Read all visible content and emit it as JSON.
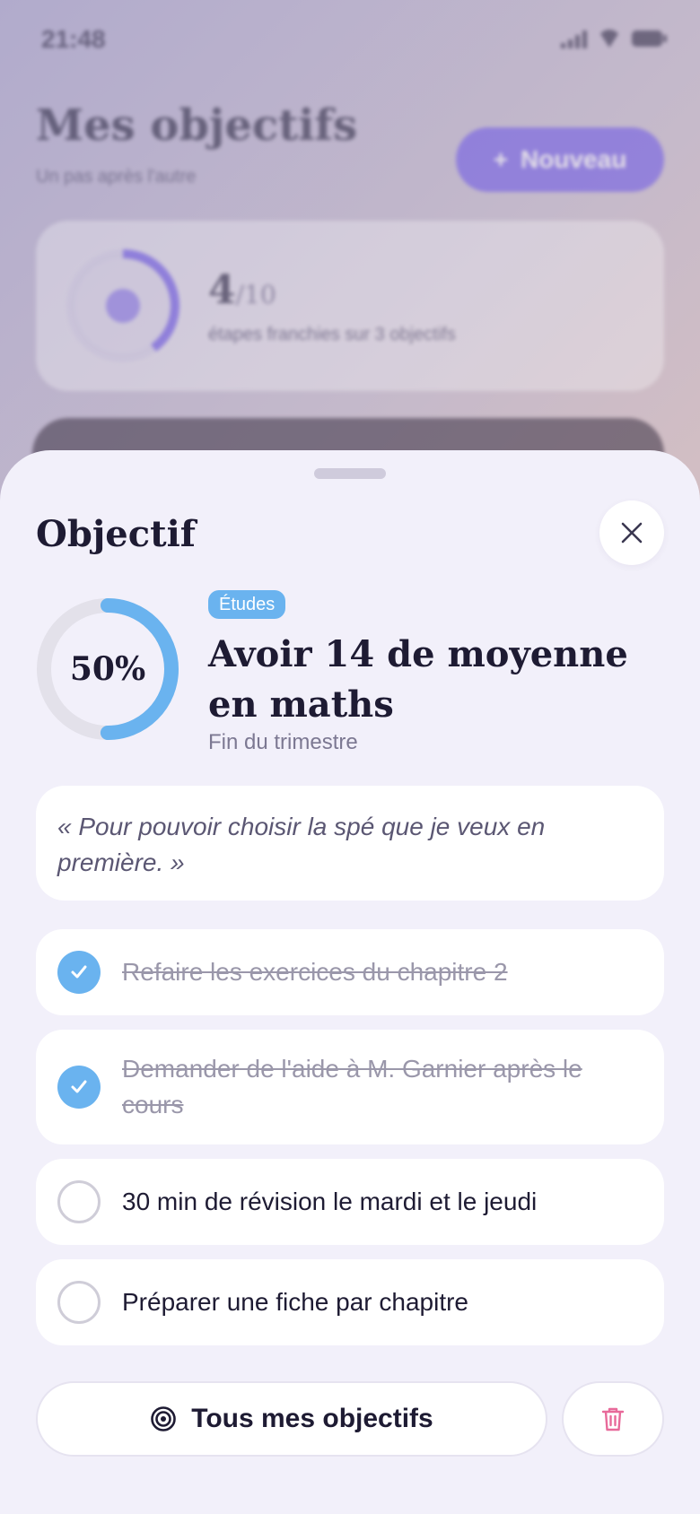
{
  "status_bar": {
    "time": "21:48"
  },
  "background": {
    "title": "Mes objectifs",
    "subtitle": "Un pas après l'autre",
    "new_button": {
      "icon": "plus-icon",
      "label": "Nouveau"
    },
    "summary": {
      "done": "4",
      "total": "/10",
      "description": "étapes franchies sur 3 objectifs",
      "progress": 0.4
    }
  },
  "sheet": {
    "title": "Objectif",
    "close_icon": "close-icon",
    "goal": {
      "progress_percent": 50,
      "progress_label": "50%",
      "category": "Études",
      "title": "Avoir 14 de moyenne en maths",
      "deadline": "Fin du trimestre",
      "motivation": "« Pour pouvoir choisir la spé que je veux en première. »"
    },
    "steps": [
      {
        "label": "Refaire les exercices du chapitre 2",
        "done": true
      },
      {
        "label": "Demander de l'aide à M. Garnier après le cours",
        "done": true
      },
      {
        "label": "30 min de révision le mardi et le jeudi",
        "done": false
      },
      {
        "label": "Préparer une fiche par chapitre",
        "done": false
      }
    ],
    "all_goals_button": {
      "icon": "target-icon",
      "label": "Tous mes objectifs"
    },
    "delete_button": {
      "icon": "trash-icon"
    }
  },
  "colors": {
    "accent_blue": "#6ab3ef",
    "accent_purple": "#6b55e8",
    "delete_pink": "#e86a9a",
    "text_dark": "#1e1b33"
  }
}
